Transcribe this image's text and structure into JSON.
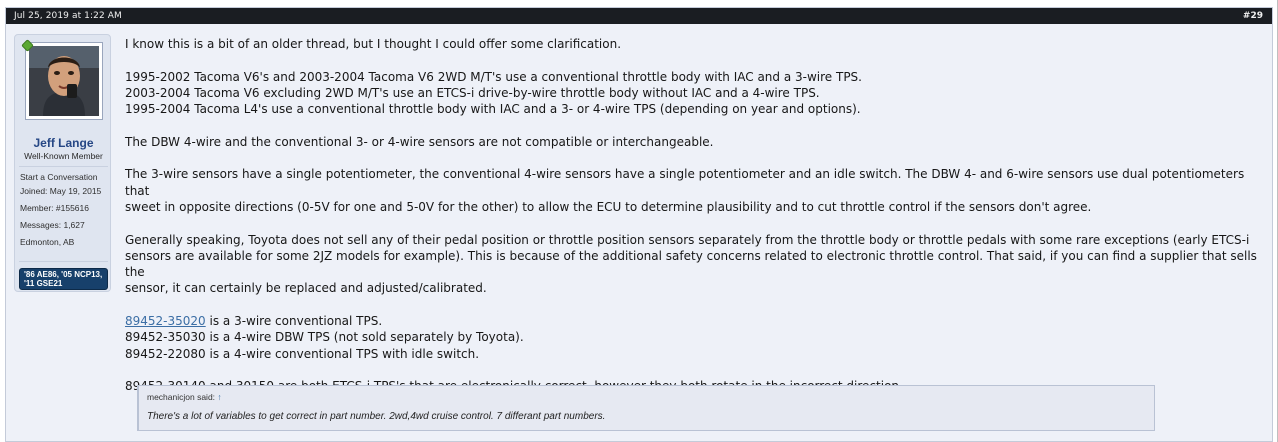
{
  "post": {
    "date": "Jul 25, 2019 at 1:22 AM",
    "number": "#29"
  },
  "user": {
    "name": "Jeff Lange",
    "title": "Well-Known Member",
    "start_conversation": "Start a Conversation",
    "joined": "Joined: May 19, 2015",
    "member": "Member: #155616",
    "messages": "Messages: 1,627",
    "location": "Edmonton, AB",
    "vehicles": "'86 AE86, '05 NCP13, '11 GSE21"
  },
  "message": {
    "p1": "I know this is a bit of an older thread, but I thought I could offer some clarification.",
    "p2_l1": "1995-2002 Tacoma V6's and 2003-2004 Tacoma V6 2WD M/T's use a conventional throttle body with IAC and a 3-wire TPS.",
    "p2_l2": "2003-2004 Tacoma V6 excluding 2WD M/T's use an ETCS-i drive-by-wire throttle body without IAC and a 4-wire TPS.",
    "p2_l3": "1995-2004 Tacoma L4's use a conventional throttle body with IAC and a 3- or 4-wire TPS (depending on year and options).",
    "p3": "The DBW 4-wire and the conventional 3- or 4-wire sensors are not compatible or interchangeable.",
    "p4_l1": "The 3-wire sensors have a single potentiometer, the conventional 4-wire sensors have a single potentiometer and an idle switch. The DBW 4- and 6-wire sensors use dual potentiometers that",
    "p4_l2": "sweet in opposite directions (0-5V for one and 5-0V for the other) to allow the ECU to determine plausibility and to cut throttle control if the sensors don't agree.",
    "p5_l1": "Generally speaking, Toyota does not sell any of their pedal position or throttle position sensors separately from the throttle body or throttle pedals with some rare exceptions (early ETCS-i",
    "p5_l2": "sensors are available for some 2JZ models for example). This is because of the additional safety concerns related to electronic throttle control. That said, if you can find a supplier that sells the",
    "p5_l3": "sensor, it can certainly be replaced and adjusted/calibrated.",
    "p6_link": "89452-35020",
    "p6_l1_rest": " is a 3-wire conventional TPS.",
    "p6_l2": "89452-35030 is a 4-wire DBW TPS (not sold separately by Toyota).",
    "p6_l3": "89452-22080 is a 4-wire conventional TPS with idle switch.",
    "p7": "89452-30140 and 30150 are both ETCS-i TPS's that are electronically correct, however they both rotate in the incorrect direction."
  },
  "quote": {
    "author": "mechanicjon said: ",
    "link_glyph": "↑",
    "text": "There's a lot of variables to get correct in part number. 2wd,4wd cruise control. 7 differant part numbers."
  },
  "colors": {
    "header_bg": "#1a1d22",
    "post_bg": "#eef1f8",
    "username": "#264785",
    "link": "#3b6ea5",
    "badge_bg": "#17406b"
  }
}
